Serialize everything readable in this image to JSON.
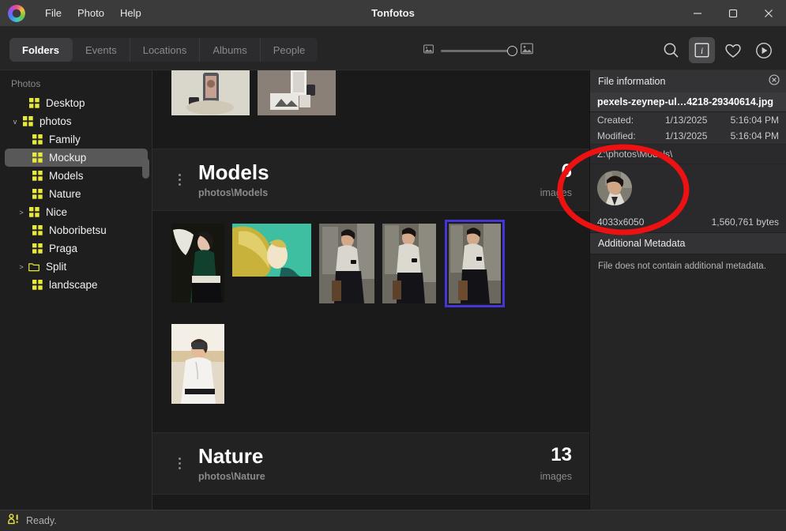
{
  "window": {
    "title": "Tonfotos",
    "logo_icon": "color-ring-logo-icon",
    "minimize_label": "–",
    "maximize_label": "☐",
    "close_label": "×"
  },
  "menubar": {
    "items": [
      {
        "label": "File"
      },
      {
        "label": "Photo"
      },
      {
        "label": "Help"
      }
    ]
  },
  "tabs": [
    {
      "label": "Folders",
      "active": true
    },
    {
      "label": "Events",
      "active": false
    },
    {
      "label": "Locations",
      "active": false
    },
    {
      "label": "Albums",
      "active": false
    },
    {
      "label": "People",
      "active": false
    }
  ],
  "toolbar": {
    "zoom_small_icon": "small-image-icon",
    "zoom_large_icon": "large-image-icon",
    "zoom_value": 100,
    "actions": [
      {
        "name": "search-icon",
        "label": "Search",
        "active": false
      },
      {
        "name": "info-icon",
        "label": "i",
        "active": true
      },
      {
        "name": "heart-icon",
        "label": "Favorites",
        "active": false
      },
      {
        "name": "play-icon",
        "label": "Slideshow",
        "active": false
      }
    ]
  },
  "sidebar": {
    "header": "Photos",
    "items": [
      {
        "label": "Desktop",
        "icon": "grid-folder-icon",
        "indent": 1,
        "chevron": "",
        "selected": false
      },
      {
        "label": "photos",
        "icon": "grid-folder-icon",
        "indent": 0,
        "chevron": "v",
        "selected": false
      },
      {
        "label": "Family",
        "icon": "grid-folder-icon",
        "indent": 2,
        "chevron": "",
        "selected": false
      },
      {
        "label": "Mockup",
        "icon": "grid-folder-icon",
        "indent": 2,
        "chevron": "",
        "selected": true
      },
      {
        "label": "Models",
        "icon": "grid-folder-icon",
        "indent": 2,
        "chevron": "",
        "selected": false
      },
      {
        "label": "Nature",
        "icon": "grid-folder-icon",
        "indent": 2,
        "chevron": "",
        "selected": false
      },
      {
        "label": "Nice",
        "icon": "grid-folder-icon",
        "indent": 1,
        "chevron": ">",
        "selected": false
      },
      {
        "label": "Noboribetsu",
        "icon": "grid-folder-icon",
        "indent": 2,
        "chevron": "",
        "selected": false
      },
      {
        "label": "Praga",
        "icon": "grid-folder-icon",
        "indent": 2,
        "chevron": "",
        "selected": false
      },
      {
        "label": "Split",
        "icon": "outline-folder-icon",
        "indent": 1,
        "chevron": ">",
        "selected": false
      },
      {
        "label": "landscape",
        "icon": "grid-folder-icon",
        "indent": 2,
        "chevron": "",
        "selected": false
      }
    ]
  },
  "sections": [
    {
      "title": "Models",
      "path": "photos\\Models",
      "count": "6",
      "count_label": "images"
    },
    {
      "title": "Nature",
      "path": "photos\\Nature",
      "count": "13",
      "count_label": "images"
    }
  ],
  "info_panel": {
    "title": "File information",
    "close_icon": "close-circle-icon",
    "filename": "pexels-zeynep-ul…4218-29340614.jpg",
    "rows": [
      {
        "key": "Created:",
        "date": "1/13/2025",
        "time": "5:16:04 PM"
      },
      {
        "key": "Modified:",
        "date": "1/13/2025",
        "time": "5:16:04 PM"
      }
    ],
    "path": "Z:\\photos\\Models\\",
    "avatar_name": "face-thumbnail-avatar",
    "dimensions": "4033x6050",
    "filesize": "1,560,761 bytes",
    "metadata_header": "Additional Metadata",
    "metadata_note": "File does not contain additional metadata."
  },
  "statusbar": {
    "icon": "person-alert-icon",
    "text": "Ready."
  },
  "annotation": {
    "shape": "red-ellipse-highlight",
    "color": "#ee1111"
  },
  "colors": {
    "accent_selection": "#4335d6",
    "folder_yellow": "#e9e93c",
    "titlebar": "#3b3b3b",
    "panel": "#252526",
    "content_bg": "#1a1a1a"
  }
}
